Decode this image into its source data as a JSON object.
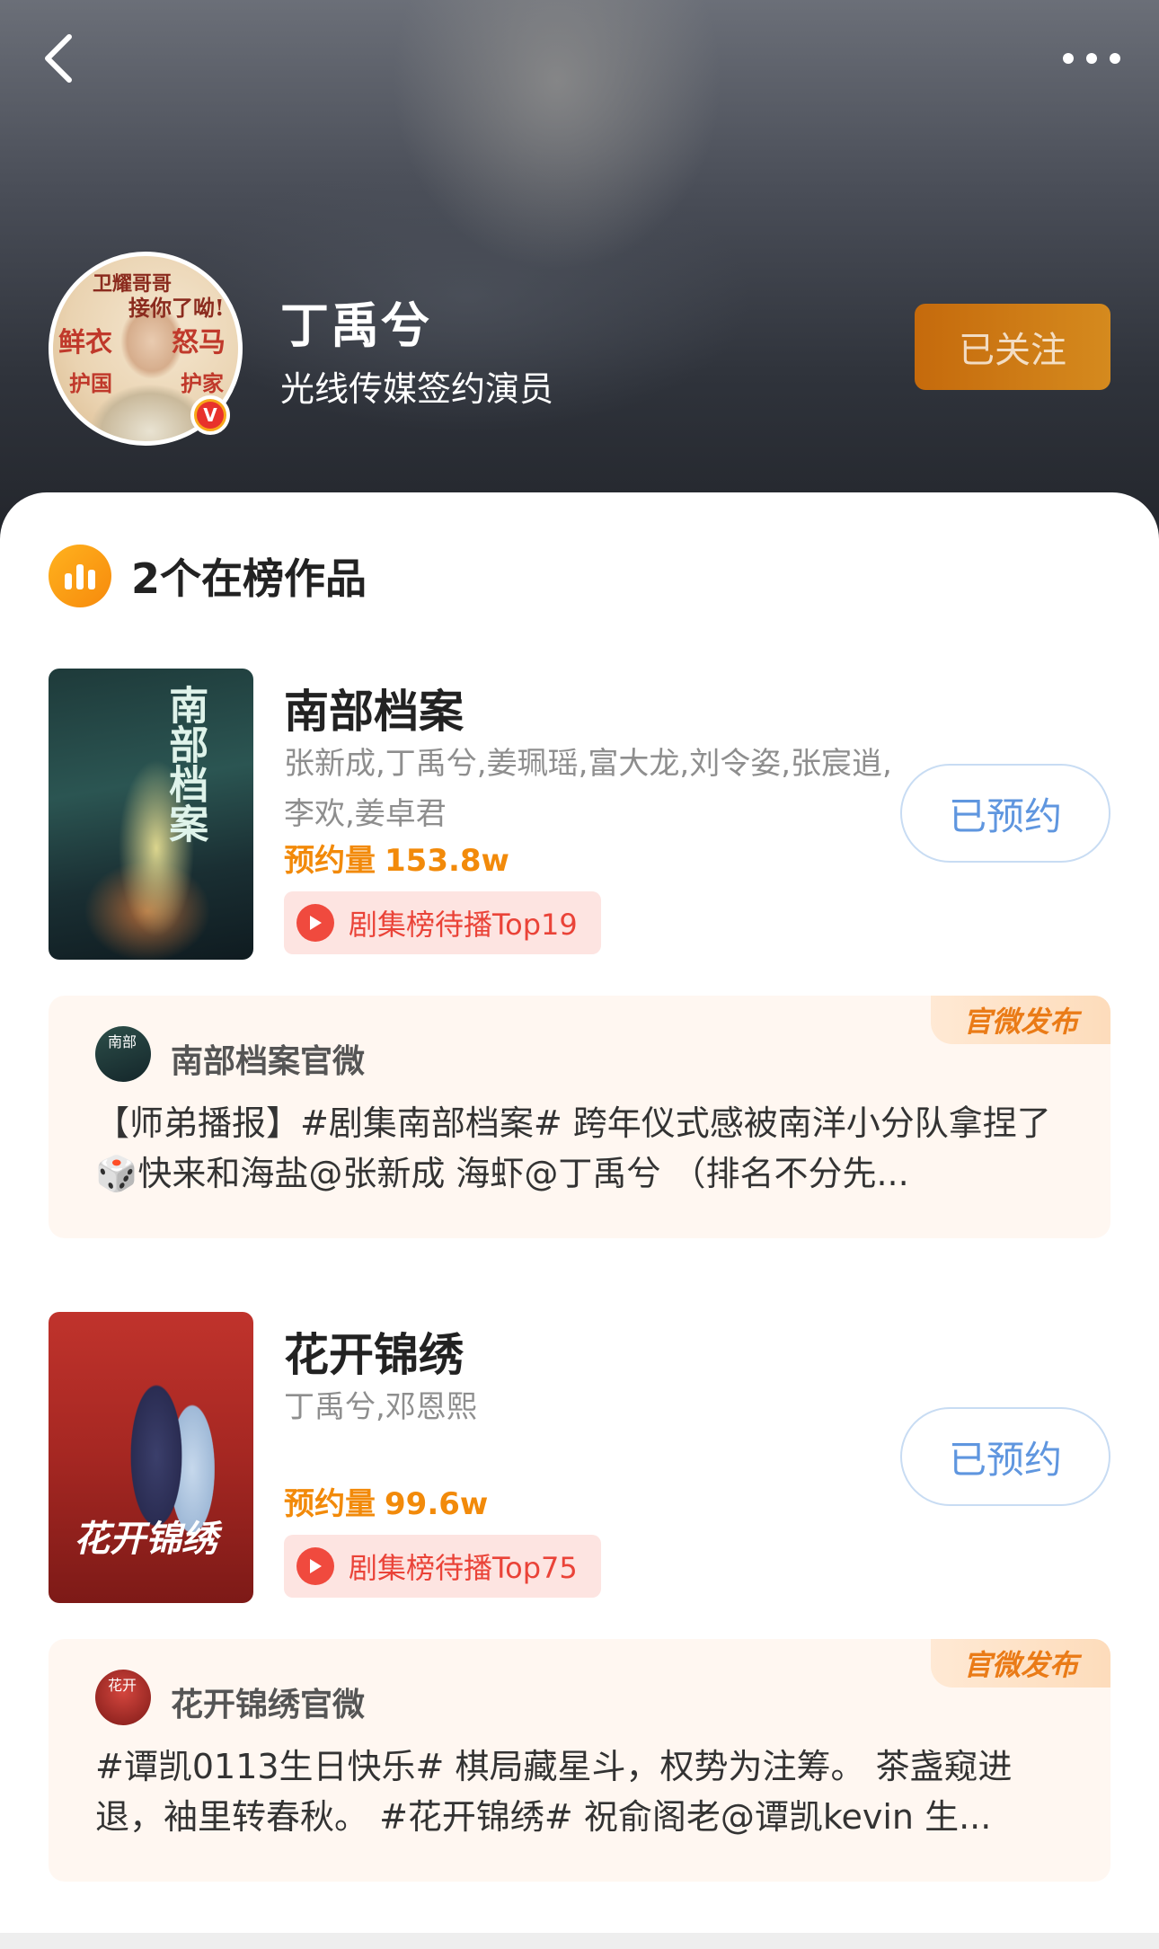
{
  "header": {
    "name": "丁禹兮",
    "description": "光线传媒签约演员",
    "follow_label": "已关注",
    "avatar_text": [
      "卫耀哥哥",
      "接你了呦!",
      "鲜衣",
      "怒马",
      "护国",
      "护家"
    ],
    "verify_mark": "V"
  },
  "section": {
    "title": "2个在榜作品"
  },
  "works": [
    {
      "title": "南部档案",
      "cast": "张新成,丁禹兮,姜珮瑶,富大龙,刘令姿,张宸逍,李欢,姜卓君",
      "reserve_label": "预约量",
      "reserve_value": "153.8w",
      "rank_label": "剧集榜待播Top19",
      "button_label": "已预约",
      "poster_text": "南部档案",
      "post": {
        "tag": "官微发布",
        "author": "南部档案官微",
        "text": "【师弟播报】#剧集南部档案# 跨年仪式感被南洋小分队拿捏了🎲快来和海盐@张新成 海虾@丁禹兮 （排名不分先...",
        "avatar_text": "南部"
      }
    },
    {
      "title": "花开锦绣",
      "cast": "丁禹兮,邓恩熙",
      "reserve_label": "预约量",
      "reserve_value": "99.6w",
      "rank_label": "剧集榜待播Top75",
      "button_label": "已预约",
      "poster_text": "花开锦绣",
      "post": {
        "tag": "官微发布",
        "author": "花开锦绣官微",
        "text": "#谭凯0113生日快乐# 棋局藏星斗，权势为注筹。 茶盏窥进退，袖里转春秋。 #花开锦绣# 祝俞阁老@谭凯kevin 生...",
        "avatar_text": "花开"
      }
    }
  ],
  "icons": {
    "back": "chevron-left-icon",
    "more": "more-dots-icon",
    "chart": "bar-chart-icon",
    "play": "play-icon",
    "verify": "verified-badge-icon"
  },
  "colors": {
    "accent_orange": "#f28a0a",
    "follow_btn": "#c56a0c",
    "reserve_btn_text": "#5f96df",
    "rank_tag_bg": "#fde4e1",
    "rank_tag_text": "#ea4338",
    "post_bg": "#fff7f1"
  }
}
